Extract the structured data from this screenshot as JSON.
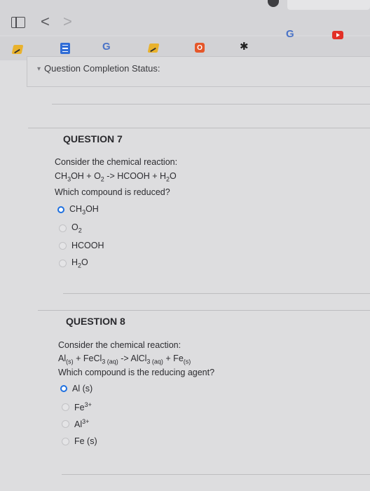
{
  "toolbar": {
    "back": "<",
    "forward": ">"
  },
  "favorites": [
    {
      "icon": "pencil-icon"
    },
    {
      "icon": "list-icon"
    },
    {
      "label": "G"
    },
    {
      "icon": "pencil-icon"
    },
    {
      "label": "O"
    },
    {
      "icon": "star-icon"
    },
    {
      "label": "G"
    },
    {
      "icon": "youtube-icon"
    }
  ],
  "status": {
    "label": "Question Completion Status:"
  },
  "q7": {
    "title": "QUESTION 7",
    "prompt": "Consider the chemical reaction:",
    "question": "Which compound is reduced?",
    "options": [
      "CH3OH",
      "O2",
      "HCOOH",
      "H2O"
    ],
    "selected": 0
  },
  "q8": {
    "title": "QUESTION 8",
    "prompt": "Consider the chemical reaction:",
    "question": "Which compound is the reducing agent?",
    "options": [
      "Al (s)",
      "Fe3+",
      "Al3+",
      "Fe (s)"
    ],
    "selected": 0
  },
  "colors": {
    "accent": "#1d6fe0",
    "background": "#dddddf"
  }
}
